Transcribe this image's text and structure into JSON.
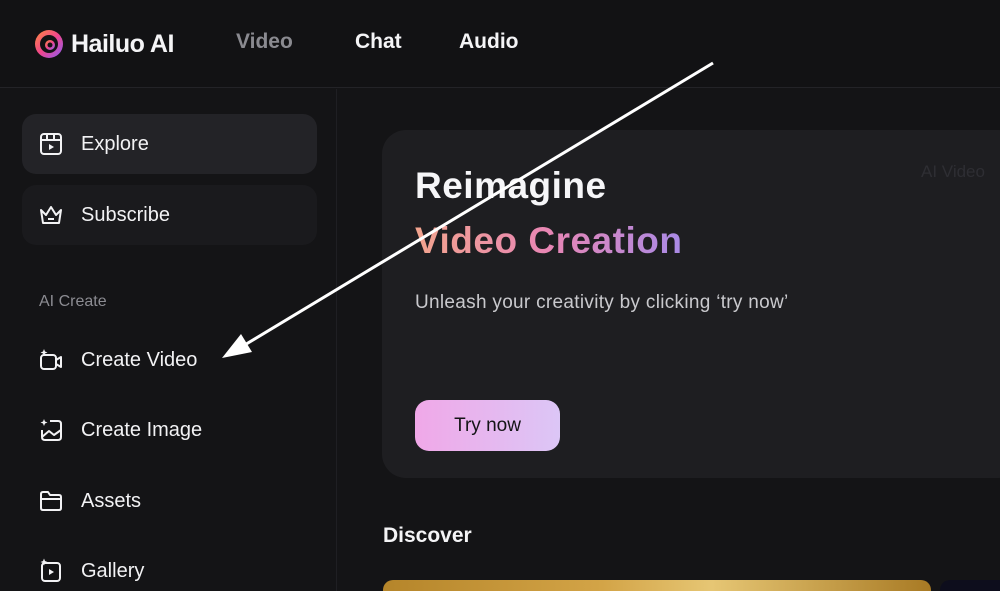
{
  "header": {
    "logo_text": "Hailuo AI",
    "nav": {
      "video": "Video",
      "chat": "Chat",
      "audio": "Audio"
    }
  },
  "sidebar": {
    "explore": "Explore",
    "subscribe": "Subscribe",
    "section_label": "AI Create",
    "items": [
      {
        "label": "Create Video",
        "icon": "video-sparkle-icon"
      },
      {
        "label": "Create Image",
        "icon": "image-sparkle-icon"
      },
      {
        "label": "Assets",
        "icon": "folder-icon"
      },
      {
        "label": "Gallery",
        "icon": "gallery-play-icon"
      }
    ]
  },
  "hero": {
    "title_line1": "Reimagine",
    "title_line2": "Video Creation",
    "subtitle": "Unleash your creativity by clicking ‘try now’",
    "tag": "AI Video",
    "button": "Try now"
  },
  "main": {
    "discover": "Discover"
  },
  "colors": {
    "background": "#141416",
    "card": "#1e1e21",
    "gradient_start": "#f2a48e",
    "gradient_end": "#a98ae6",
    "button_start": "#f0a8e8",
    "button_end": "#dcc6f6"
  }
}
